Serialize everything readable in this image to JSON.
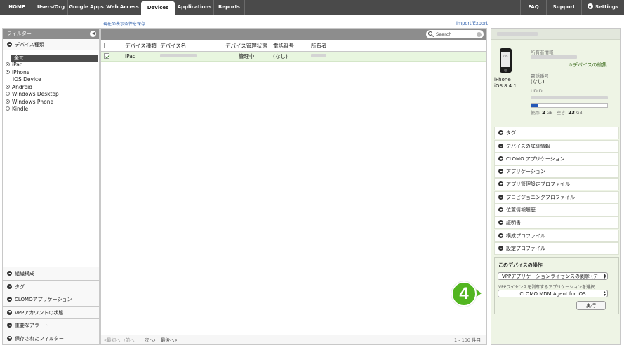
{
  "nav": {
    "items": [
      "HOME",
      "Users/Org",
      "Google Apps",
      "Web Access",
      "Devices",
      "Applications",
      "Reports"
    ],
    "active": "Devices",
    "right_items": [
      "FAQ",
      "Support",
      "Settings"
    ]
  },
  "links": {
    "save_filter": "現在の表示条件を保存",
    "import_export": "Import/Export"
  },
  "sidebar": {
    "header": "フィルター",
    "device_type_section": "デバイス種類",
    "tree_all": "全て",
    "tree": [
      "iPad",
      "iPhone",
      "iOS Device",
      "Android",
      "Windows Desktop",
      "Windows Phone",
      "Kindle"
    ],
    "bottom_sections": [
      "組織構成",
      "タグ",
      "CLOMOアプリケーション",
      "VPPアカウントの状態",
      "重要なアラート",
      "保存されたフィルター"
    ]
  },
  "table": {
    "search_placeholder": "Search",
    "columns": [
      "デバイス種類",
      "デバイス名",
      "デバイス管理状態",
      "電話番号",
      "所有者"
    ],
    "rows": [
      {
        "type": "iPad",
        "status": "管理中",
        "phone": "(なし)",
        "checked": true
      }
    ],
    "pager": {
      "first": "«最初へ",
      "prev": "‹前へ",
      "next": "次へ›",
      "last": "最後へ»",
      "range": "1 - 100 件目"
    }
  },
  "details": {
    "device_name_line1": "iPhone",
    "device_name_line2": "iOS 8.4.1",
    "ios_badge": "iOS",
    "owner_label": "所有者情報",
    "edit_link": "デバイスの編集",
    "phone_label": "電話番号",
    "phone_value": "(なし)",
    "udid_label": "UDID",
    "storage": {
      "used_label": "使用:",
      "used_value": "2",
      "free_label": "空き:",
      "free_value": "23",
      "unit": "GB",
      "used_fraction": 0.08
    },
    "sections": [
      "タグ",
      "デバイスの詳細情報",
      "CLOMO アプリケーション",
      "アプリケーション",
      "アプリ管理設定プロファイル",
      "プロビジョニングプロファイル",
      "位置情報履歴",
      "証明書",
      "構成プロファイル",
      "設定プロファイル"
    ],
    "operations": {
      "title": "このデバイスの操作",
      "action_select": "VPPアプリケーションライセンスの剥奪 (デ",
      "note": "VPPライセンスを剥奪するアプリケーションを選択",
      "app_select": "CLOMO MDM Agent for iOS",
      "execute": "実行"
    }
  },
  "step_badge": "4",
  "colors": {
    "accent_green": "#52b520",
    "nav_bg": "#4a4a4a",
    "selected_row": "#e8f6df",
    "storage_fill": "#2458b8"
  }
}
